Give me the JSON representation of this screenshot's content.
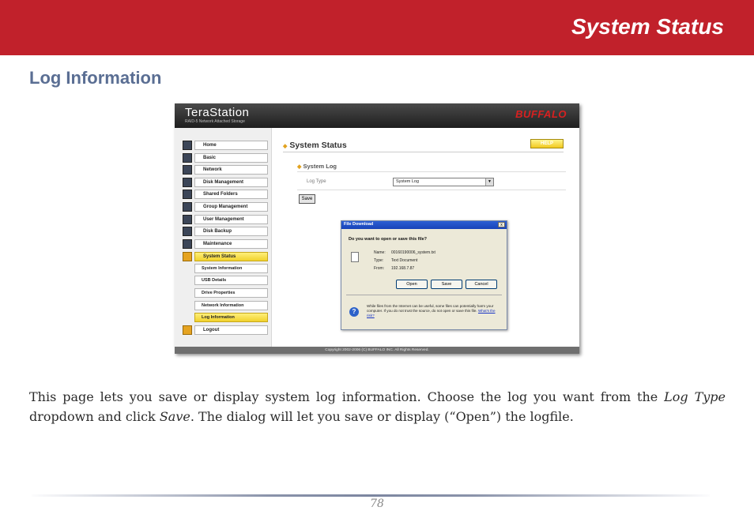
{
  "header": {
    "title": "System Status"
  },
  "section": {
    "title": "Log Information"
  },
  "screenshot": {
    "brand": "TeraStation",
    "brand_sub": "RAID-5 Network Attached Storage",
    "vendor": "BUFFALO",
    "sidebar": [
      {
        "label": "Home"
      },
      {
        "label": "Basic"
      },
      {
        "label": "Network"
      },
      {
        "label": "Disk Management"
      },
      {
        "label": "Shared Folders"
      },
      {
        "label": "Group Management"
      },
      {
        "label": "User Management"
      },
      {
        "label": "Disk Backup"
      },
      {
        "label": "Maintenance"
      },
      {
        "label": "System Status"
      },
      {
        "label": "System Information"
      },
      {
        "label": "USB Details"
      },
      {
        "label": "Drive Properties"
      },
      {
        "label": "Network Information"
      },
      {
        "label": "Log Information"
      },
      {
        "label": "Logout"
      }
    ],
    "page_title": "System Status",
    "help": "HELP",
    "sub_title": "System Log",
    "log_type_label": "Log Type",
    "log_type_value": "System Log",
    "save_label": "Save",
    "dialog": {
      "title": "File Download",
      "close": "x",
      "question": "Do you want to open or save this file?",
      "name_label": "Name:",
      "name_value": "00160190006_system.txt",
      "type_label": "Type:",
      "type_value": "Text Document",
      "from_label": "From:",
      "from_value": "192.168.7.87",
      "open": "Open",
      "save": "Save",
      "cancel": "Cancel",
      "warning": "While files from the Internet can be useful, some files can potentially harm your computer. If you do not trust the source, do not open or save this file.",
      "risk_link": "What's the risk?"
    },
    "copyright": "Copyright 2002-2006 (C) BUFFALO INC. All Rights Reserved."
  },
  "body": {
    "t1": "This page lets you save or display system log information.  Choose the log you want from the ",
    "em1": "Log Type",
    "t2": " dropdown and click ",
    "em2": "Save",
    "t3": ".  The dialog will let you save or display (“Open”) the logfile."
  },
  "page_number": "78",
  "colors": {
    "banner": "#c1212b",
    "section_title": "#5a6e93"
  }
}
